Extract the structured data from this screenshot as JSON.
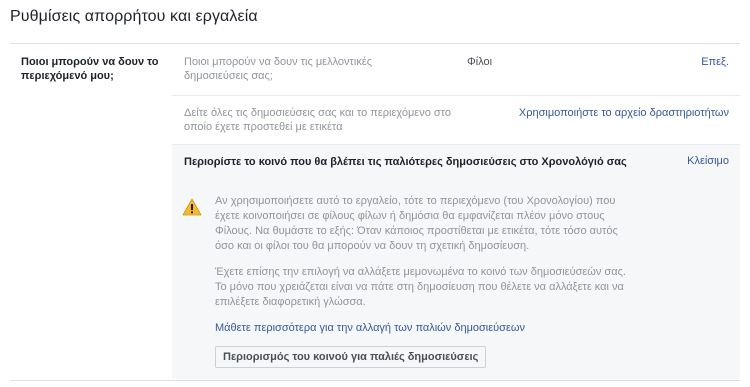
{
  "header": {
    "title": "Ρυθμίσεις απορρήτου και εργαλεία"
  },
  "section": {
    "label": "Ποιοι μπορούν να δουν το περιεχόμενό μου;"
  },
  "rows": [
    {
      "description": "Ποιοι μπορούν να δουν τις μελλοντικές δημοσιεύσεις σας;",
      "value": "Φίλοι",
      "action": "Επεξ."
    },
    {
      "description": "Δείτε όλες τις δημοσιεύσεις σας και το περιεχόμενο στο οποίο έχετε προστεθεί με ετικέτα",
      "action": "Χρησιμοποιήστε το αρχείο δραστηριοτήτων"
    }
  ],
  "limit_past_posts": {
    "title": "Περιορίστε το κοινό που θα βλέπει τις παλιότερες δημοσιεύσεις στο Χρονολόγιό σας",
    "close": "Κλείσιμο",
    "warning_icon": "warning-triangle-icon",
    "paragraph1": "Αν χρησιμοποιήσετε αυτό το εργαλείο, τότε το περιεχόμενο (του Χρονολογίου) που έχετε κοινοποιήσει σε φίλους φίλων ή δημόσια θα εμφανίζεται πλέον μόνο στους Φίλους. Να θυμάστε το εξής: Όταν κάποιος προστίθεται με ετικέτα, τότε τόσο αυτός όσο και οι φίλοι του θα μπορούν να δουν τη σχετική δημοσίευση.",
    "paragraph2": "Έχετε επίσης την επιλογή να αλλάξετε μεμονωμένα το κοινό των δημοσιεύσεών σας. Το μόνο που χρειάζεται είναι να πάτε στη δημοσίευση που θέλετε να αλλάξετε και να επιλέξετε διαφορετική γλώσσα.",
    "learn_more": "Μάθετε περισσότερα για την αλλαγή των παλιών δημοσιεύσεων",
    "button": "Περιορισμός του κοινού για παλιές δημοσιεύσεις"
  },
  "colors": {
    "link": "#365899",
    "muted_text": "#90949c",
    "panel_bg": "#f6f7f9",
    "warning": "#f7b928"
  }
}
